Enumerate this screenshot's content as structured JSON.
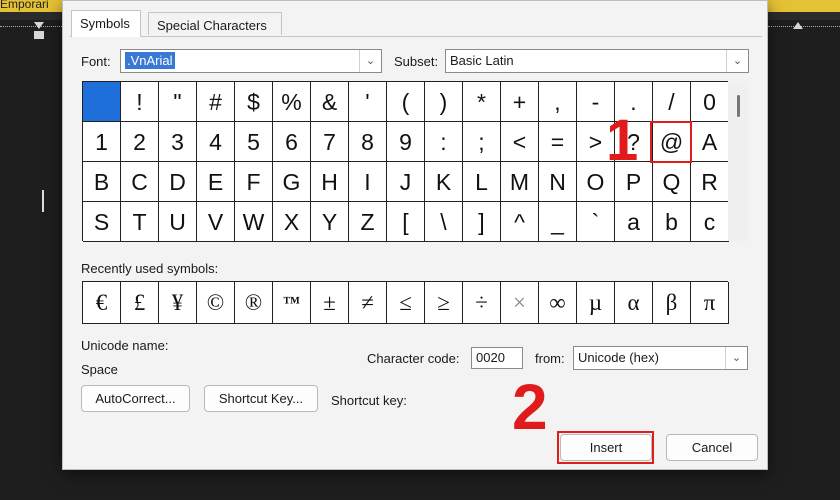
{
  "background": {
    "doc_title": "Emporari"
  },
  "dialog": {
    "tabs": [
      "Symbols",
      "Special Characters"
    ],
    "font_label": "Font:",
    "font_value": ".VnArial",
    "subset_label": "Subset:",
    "subset_value": "Basic Latin",
    "symbols": [
      " ",
      "!",
      "\"",
      "#",
      "$",
      "%",
      "&",
      "'",
      "(",
      ")",
      "*",
      "+",
      ",",
      "-",
      ".",
      "/",
      "0",
      "1",
      "2",
      "3",
      "4",
      "5",
      "6",
      "7",
      "8",
      "9",
      ":",
      ";",
      "<",
      "=",
      ">",
      "?",
      "@",
      "A",
      "B",
      "C",
      "D",
      "E",
      "F",
      "G",
      "H",
      "I",
      "J",
      "K",
      "L",
      "M",
      "N",
      "O",
      "P",
      "Q",
      "R",
      "S",
      "T",
      "U",
      "V",
      "W",
      "X",
      "Y",
      "Z",
      "[",
      "\\",
      "]",
      "^",
      "_",
      "`",
      "a",
      "b",
      "c"
    ],
    "selected_symbol_index": 0,
    "recent_label": "Recently used symbols:",
    "recent_symbols": [
      "€",
      "£",
      "¥",
      "©",
      "®",
      "™",
      "±",
      "≠",
      "≤",
      "≥",
      "÷",
      "×",
      "∞",
      "µ",
      "α",
      "β",
      "π"
    ],
    "unicode_name_label": "Unicode name:",
    "unicode_name_value": "Space",
    "char_code_label": "Character code:",
    "char_code_value": "0020",
    "from_label": "from:",
    "from_value": "Unicode (hex)",
    "autocorrect_label": "AutoCorrect...",
    "shortcut_key_button_label": "Shortcut Key...",
    "shortcut_key_label": "Shortcut key:",
    "insert_label": "Insert",
    "cancel_label": "Cancel"
  },
  "annotations": {
    "step1": "1",
    "step2": "2"
  },
  "colors": {
    "highlight": "#e01d1d",
    "selection": "#1e6fd9"
  }
}
